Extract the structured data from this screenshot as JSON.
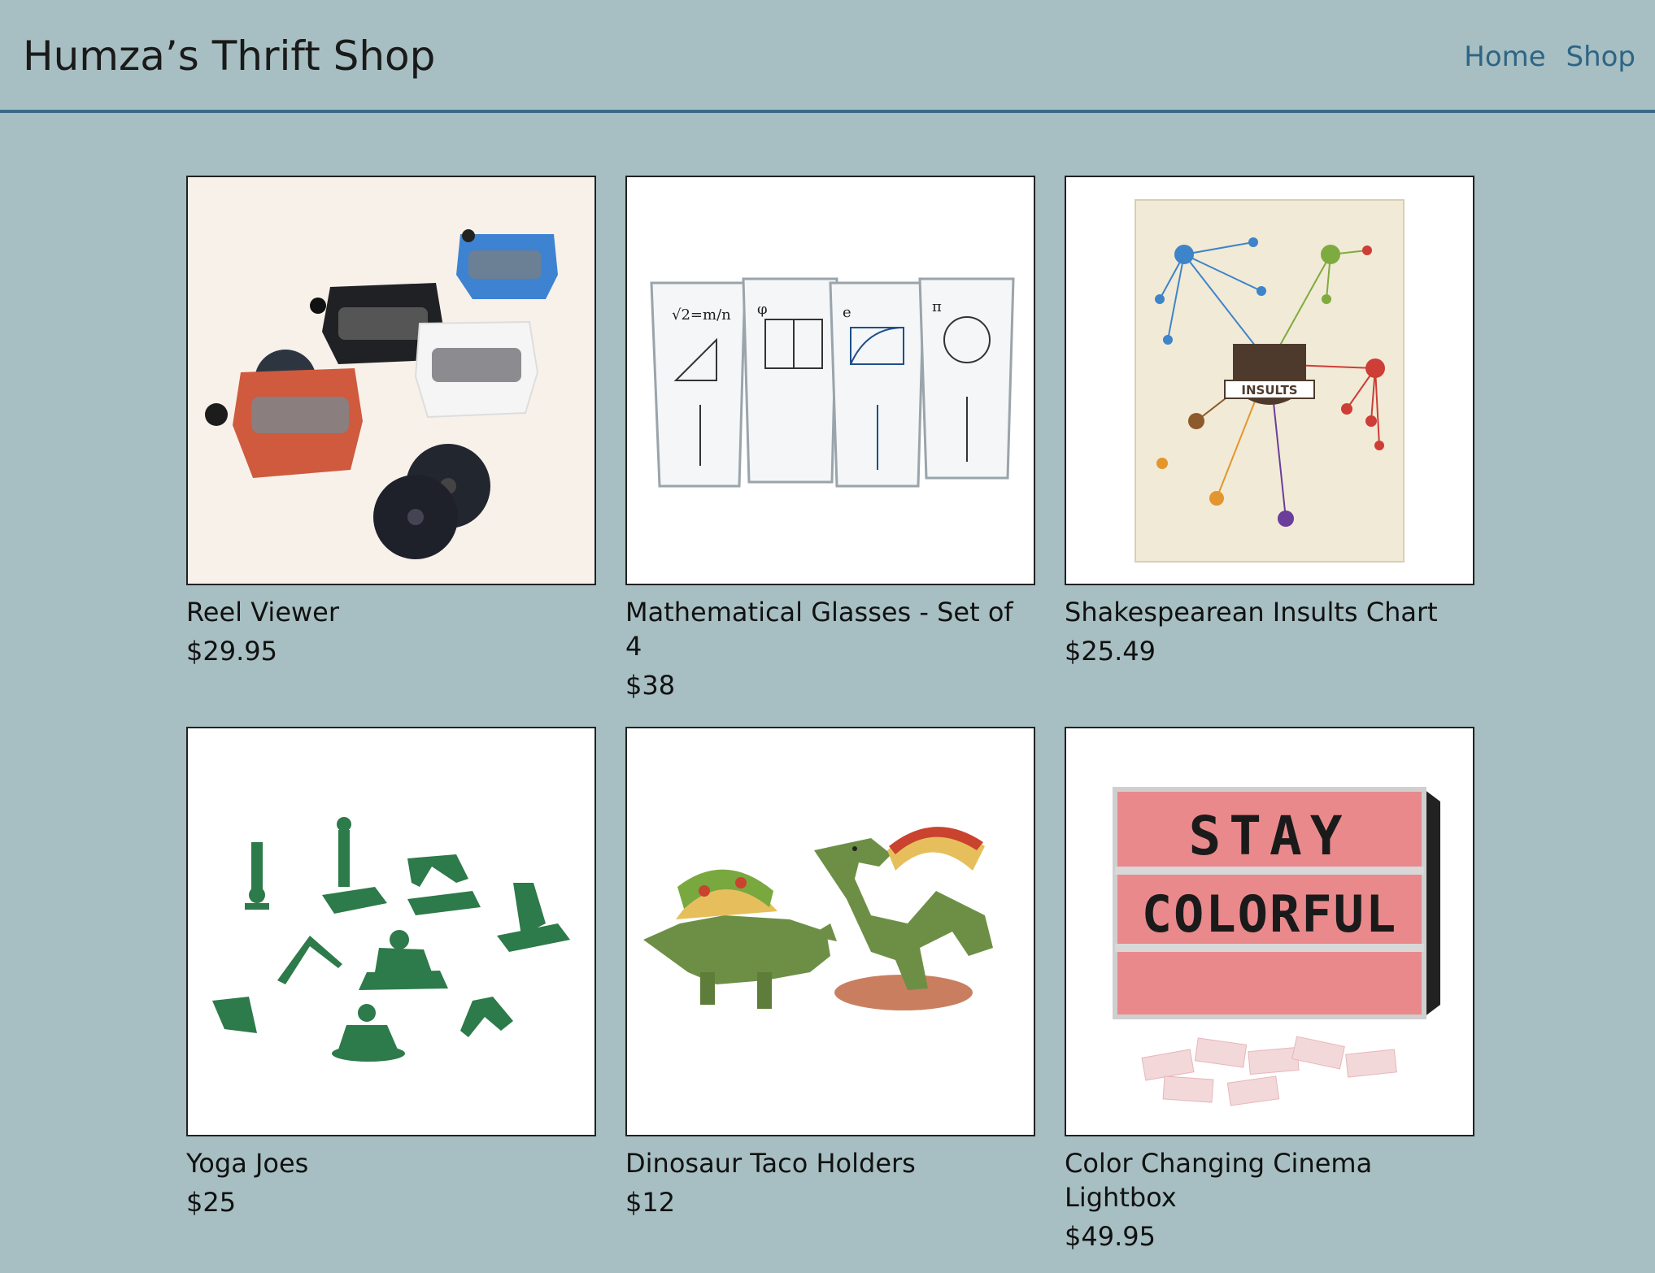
{
  "header": {
    "title": "Humza’s Thrift Shop",
    "nav": [
      {
        "label": "Home"
      },
      {
        "label": "Shop"
      }
    ]
  },
  "products": [
    {
      "name": "Reel Viewer",
      "price": "$29.95",
      "image_icon": "reel-viewer-image"
    },
    {
      "name": "Mathematical Glasses - Set of 4",
      "price": "$38",
      "image_icon": "math-glasses-image"
    },
    {
      "name": "Shakespearean Insults Chart",
      "price": "$25.49",
      "image_icon": "insults-chart-image"
    },
    {
      "name": "Yoga Joes",
      "price": "$25",
      "image_icon": "yoga-joes-image"
    },
    {
      "name": "Dinosaur Taco Holders",
      "price": "$12",
      "image_icon": "dino-taco-image"
    },
    {
      "name": "Color Changing Cinema Lightbox",
      "price": "$49.95",
      "image_icon": "lightbox-image"
    }
  ],
  "image_text": {
    "lightbox_line1": "STAY",
    "lightbox_line2": "COLORFUL",
    "insults_label": "INSULTS"
  },
  "colors": {
    "background": "#a7bfc2",
    "header_border": "#3a6a88",
    "nav_link": "#2e6585"
  }
}
